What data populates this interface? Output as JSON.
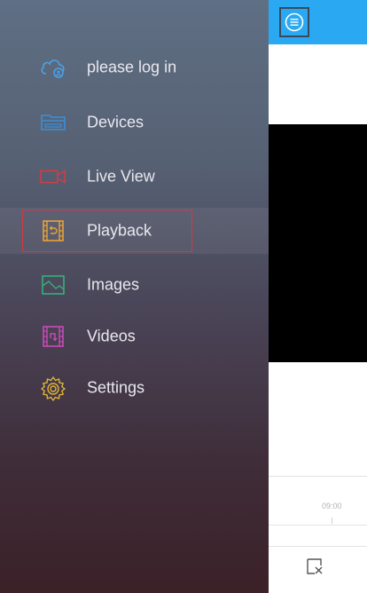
{
  "drawer": {
    "items": [
      {
        "id": "login",
        "label": "please log in",
        "icon": "cloud-user-icon",
        "color": "#4aa3e8"
      },
      {
        "id": "devices",
        "label": "Devices",
        "icon": "dvr-device-icon",
        "color": "#3b8fd8"
      },
      {
        "id": "liveview",
        "label": "Live View",
        "icon": "camera-icon",
        "color": "#d23c45"
      },
      {
        "id": "playback",
        "label": "Playback",
        "icon": "film-replay-icon",
        "color": "#e8a23a",
        "selected": true
      },
      {
        "id": "images",
        "label": "Images",
        "icon": "image-icon",
        "color": "#35b07a"
      },
      {
        "id": "videos",
        "label": "Videos",
        "icon": "video-file-icon",
        "color": "#c94bb8"
      },
      {
        "id": "settings",
        "label": "Settings",
        "icon": "gear-icon",
        "color": "#e0b437"
      }
    ]
  },
  "main": {
    "topbar_color": "#2aa8f2",
    "timeline_label": "09:00"
  }
}
